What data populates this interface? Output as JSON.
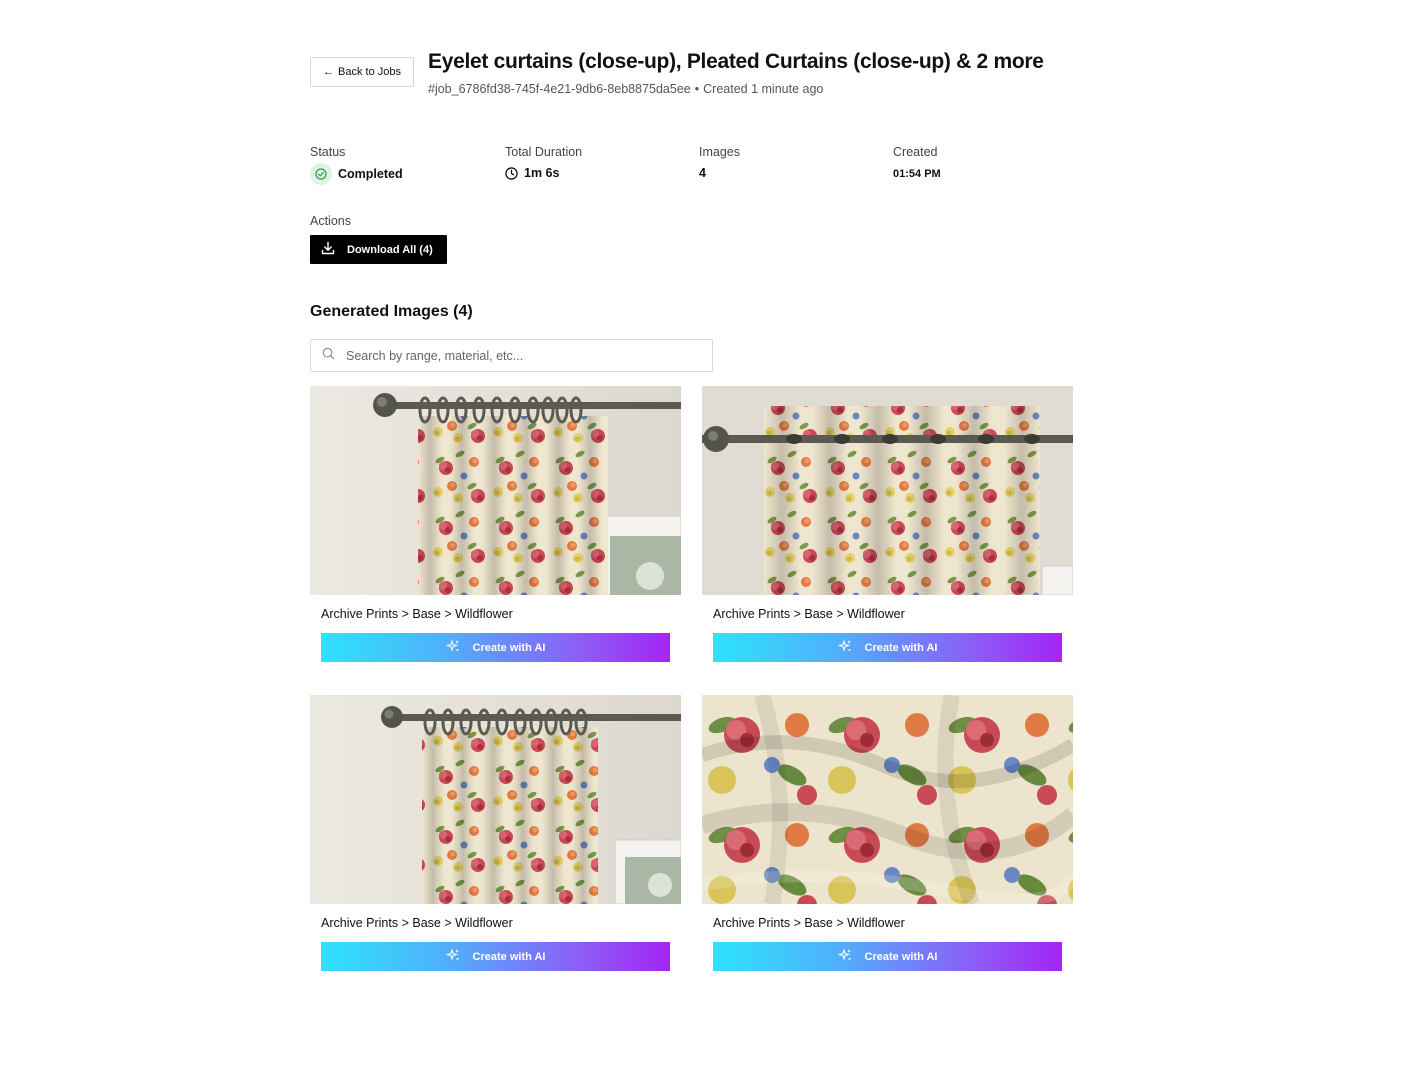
{
  "header": {
    "back_label": "Back to Jobs",
    "title": "Eyelet curtains (close-up), Pleated Curtains (close-up) & 2 more",
    "job_id": "#job_6786fd38-745f-4e21-9db6-8eb8875da5ee",
    "created_text": "Created 1 minute ago"
  },
  "stats": {
    "status": {
      "label": "Status",
      "value": "Completed"
    },
    "duration": {
      "label": "Total Duration",
      "value": "1m 6s"
    },
    "images": {
      "label": "Images",
      "value": "4"
    },
    "created": {
      "label": "Created",
      "value": "01:54 PM"
    }
  },
  "actions": {
    "label": "Actions",
    "download_label": "Download All (4)"
  },
  "gallery": {
    "title": "Generated Images (4)",
    "search_placeholder": "Search by range, material, etc...",
    "items": [
      {
        "caption": "Archive Prints > Base > Wildflower",
        "button": "Create with AI",
        "scene": "pleated-curtain"
      },
      {
        "caption": "Archive Prints > Base > Wildflower",
        "button": "Create with AI",
        "scene": "eyelet-curtain"
      },
      {
        "caption": "Archive Prints > Base > Wildflower",
        "button": "Create with AI",
        "scene": "pleated-curtain"
      },
      {
        "caption": "Archive Prints > Base > Wildflower",
        "button": "Create with AI",
        "scene": "fabric-closeup"
      }
    ]
  },
  "colors": {
    "status_badge_bg": "#dcf5e3",
    "status_check": "#2e9e52",
    "download_bg": "#000000",
    "ai_gradient": [
      "#2ee3fb",
      "#4fb1fb",
      "#8d5cf7",
      "#a325f5"
    ]
  }
}
